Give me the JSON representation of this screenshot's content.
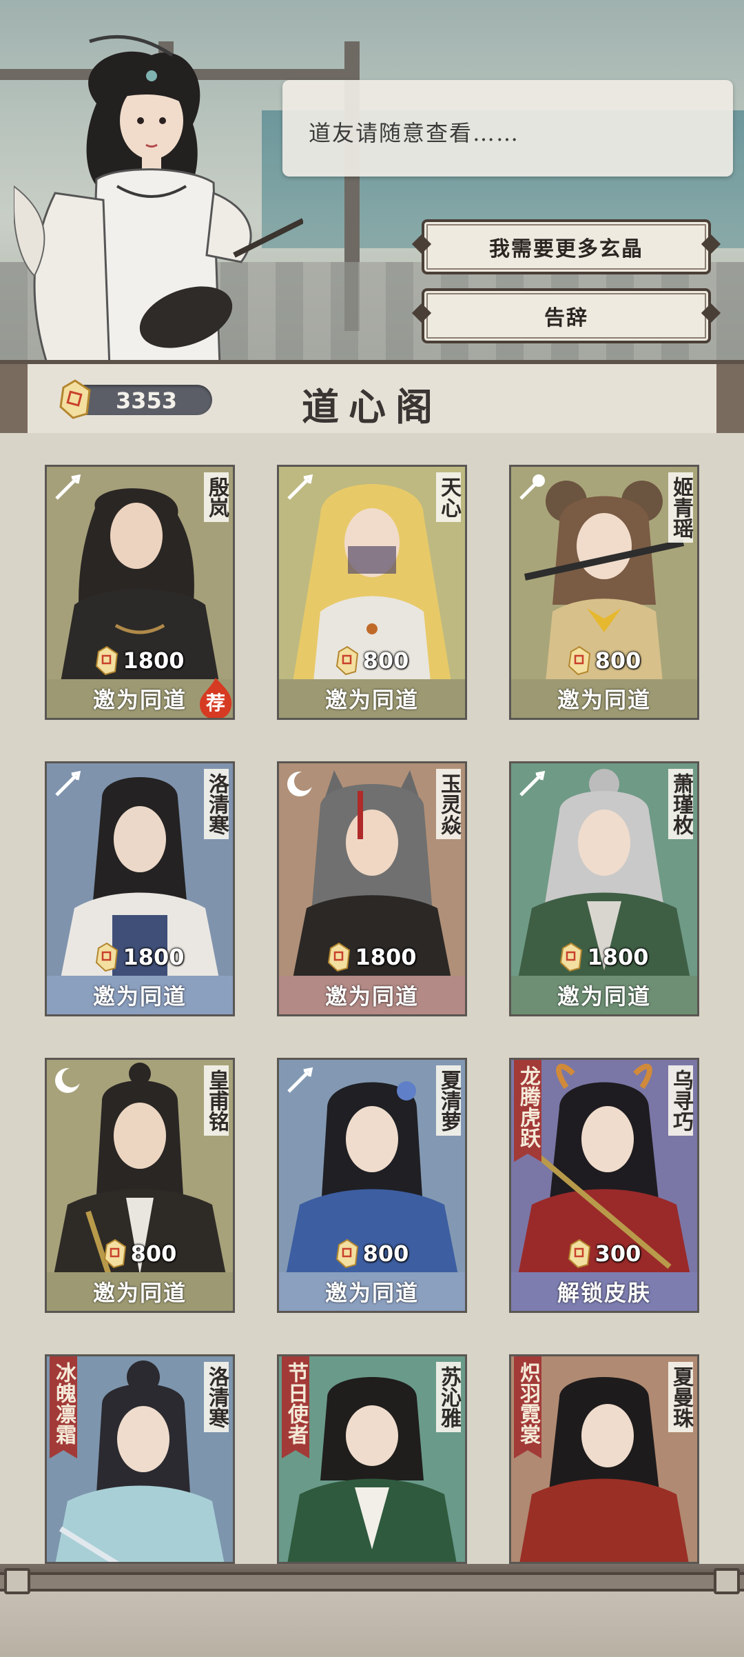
{
  "dialog": {
    "speech": "道友请随意查看……",
    "more_crystal_label": "我需要更多玄晶",
    "leave_label": "告辞"
  },
  "header": {
    "crystal_count": "3353",
    "title": "道心阁"
  },
  "cards": [
    {
      "name": "殷岚",
      "price": "1800",
      "action": "邀为同道",
      "recommended_badge": "荐",
      "type_icon": "sword-icon",
      "theme": "#b3ac78"
    },
    {
      "name": "天心",
      "price": "800",
      "action": "邀为同道",
      "type_icon": "sword-icon",
      "theme": "#b3ac78"
    },
    {
      "name": "姬青瑶",
      "price": "800",
      "action": "邀为同道",
      "type_icon": "mace-icon",
      "theme": "#b3ac78"
    },
    {
      "name": "洛清寒",
      "price": "1800",
      "action": "邀为同道",
      "type_icon": "sword-icon",
      "theme": "#8b9fbf"
    },
    {
      "name": "玉灵焱",
      "price": "1800",
      "action": "邀为同道",
      "type_icon": "moon-icon",
      "theme": "#b38a86"
    },
    {
      "name": "萧瑾枚",
      "price": "1800",
      "action": "邀为同道",
      "type_icon": "sword-icon",
      "theme": "#6e8f74"
    },
    {
      "name": "皇甫铭",
      "price": "800",
      "action": "邀为同道",
      "type_icon": "moon-icon",
      "theme": "#b3ac78"
    },
    {
      "name": "夏清萝",
      "price": "800",
      "action": "邀为同道",
      "type_icon": "sword-icon",
      "theme": "#8b9fbf"
    },
    {
      "name": "乌寻巧",
      "tag": "龙腾虎跃",
      "price": "300",
      "action": "解锁皮肤",
      "theme": "#7d7db0"
    },
    {
      "name": "洛清寒",
      "tag": "冰魄凛霜"
    },
    {
      "name": "苏沁雅",
      "tag": "节日使者"
    },
    {
      "name": "夏曼珠",
      "tag": "炽羽霓裳"
    }
  ]
}
